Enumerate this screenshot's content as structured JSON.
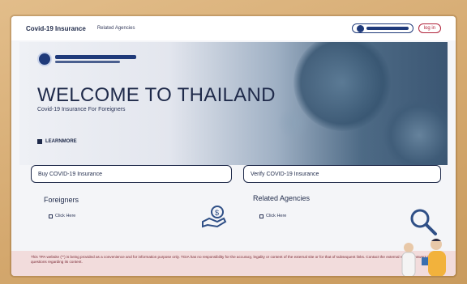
{
  "nav": {
    "brand": "Covid-19 Insurance",
    "link": "Related Agencies",
    "login": "log in"
  },
  "hero": {
    "title": "WELCOME TO THAILAND",
    "subtitle": "Covid-19 Insurance For Foreigners",
    "learn_more": "LEARNMORE"
  },
  "cards": {
    "buy": "Buy COVID-19 Insurance",
    "verify": "Verify COVID-19 Insurance"
  },
  "sections": {
    "foreigners_title": "Foreigners",
    "foreigners_click": "Click Here",
    "agencies_title": "Related Agencies",
    "agencies_click": "Click Here"
  },
  "disclaimer": "This TPA website (\"\") is being provided as a convenience and for information purpose only. TGIA has no responsibility for the accuracy, legality or content of the external site or for that of subsequent links. Contact the external site for answers to questions regarding its content.",
  "colors": {
    "navy": "#1f2a4a",
    "brand_blue": "#1f3a7a",
    "login_red": "#b0223a",
    "disclaimer_bg": "#f2dcdc"
  },
  "icons": {
    "logo": "tgia-logo-icon",
    "learn_more": "learn-more-icon",
    "hand_money": "hand-money-icon",
    "search": "magnifier-icon"
  }
}
